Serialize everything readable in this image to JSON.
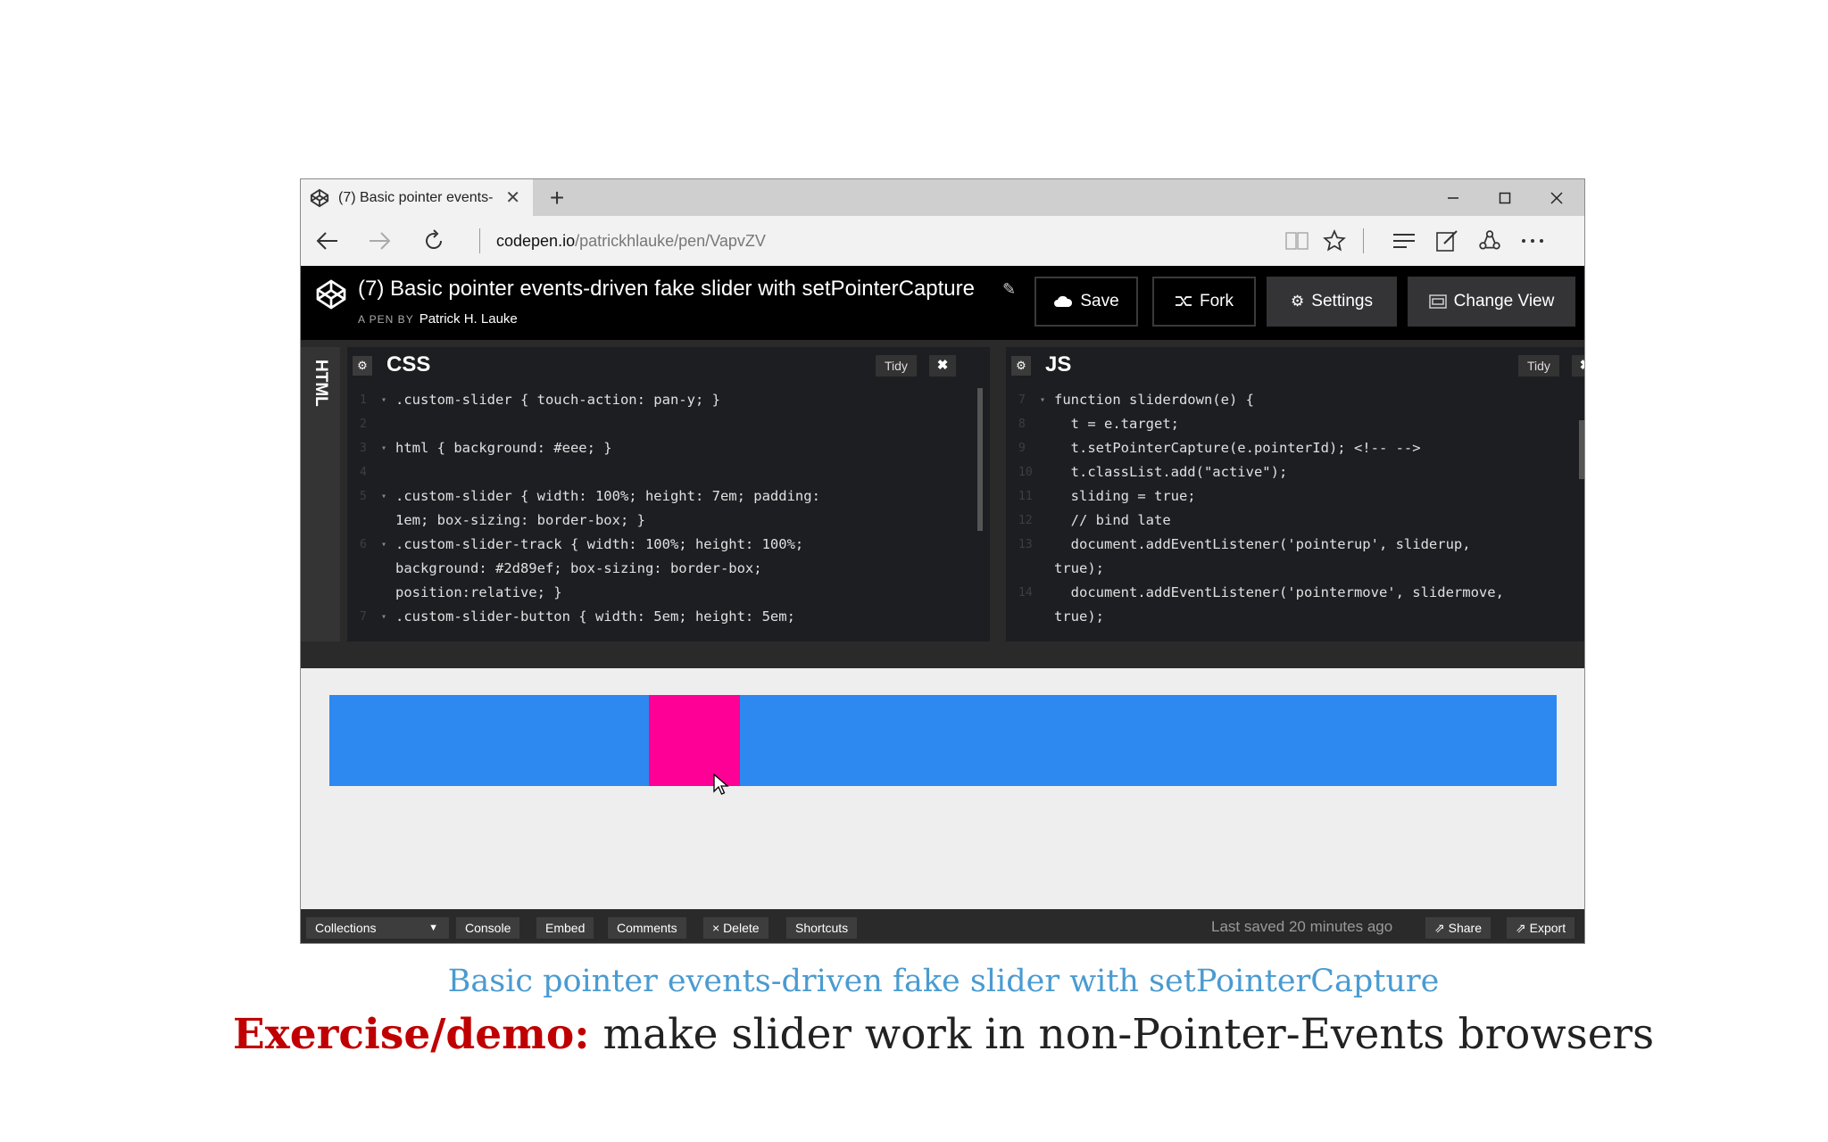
{
  "browser": {
    "tab_title": "(7) Basic pointer events-",
    "tab_close": "✕",
    "new_tab": "+",
    "url_host": "codepen.io",
    "url_path": "/patrickhlauke/pen/VapvZV"
  },
  "pen": {
    "title": "(7) Basic pointer events-driven fake slider with setPointerCapture",
    "edit_glyph": "✎",
    "by_prefix": "A PEN BY",
    "author": "Patrick H. Lauke",
    "buttons": {
      "save": "Save",
      "fork": "Fork",
      "settings": "Settings",
      "change_view": "Change View"
    }
  },
  "editors": {
    "html_label": "HTML",
    "css": {
      "title": "CSS",
      "tidy": "Tidy",
      "lines": [
        {
          "n": "1",
          "fold": "▾",
          "text": ".custom-slider { touch-action: pan-y; }"
        },
        {
          "n": "2",
          "fold": "",
          "text": ""
        },
        {
          "n": "3",
          "fold": "▾",
          "text": "html { background: #eee; }"
        },
        {
          "n": "4",
          "fold": "",
          "text": ""
        },
        {
          "n": "5",
          "fold": "▾",
          "text": ".custom-slider { width: 100%; height: 7em; padding:"
        },
        {
          "n": "",
          "fold": "",
          "text": "1em; box-sizing: border-box; }"
        },
        {
          "n": "6",
          "fold": "▾",
          "text": ".custom-slider-track { width: 100%; height: 100%;"
        },
        {
          "n": "",
          "fold": "",
          "text": "background: #2d89ef; box-sizing: border-box;"
        },
        {
          "n": "",
          "fold": "",
          "text": "position:relative; }"
        },
        {
          "n": "7",
          "fold": "▾",
          "text": ".custom-slider-button { width: 5em; height: 5em;"
        }
      ]
    },
    "js": {
      "title": "JS",
      "tidy": "Tidy",
      "lines": [
        {
          "n": "7",
          "fold": "▾",
          "text": "function sliderdown(e) {"
        },
        {
          "n": "8",
          "fold": "",
          "text": "  t = e.target;"
        },
        {
          "n": "9",
          "fold": "",
          "text": "  t.setPointerCapture(e.pointerId); <!-- -->"
        },
        {
          "n": "10",
          "fold": "",
          "text": "  t.classList.add(\"active\");"
        },
        {
          "n": "11",
          "fold": "",
          "text": "  sliding = true;"
        },
        {
          "n": "12",
          "fold": "",
          "text": "  // bind late"
        },
        {
          "n": "13",
          "fold": "",
          "text": "  document.addEventListener('pointerup', sliderup,"
        },
        {
          "n": "",
          "fold": "",
          "text": "true);"
        },
        {
          "n": "14",
          "fold": "",
          "text": "  document.addEventListener('pointermove', slidermove,"
        },
        {
          "n": "",
          "fold": "",
          "text": "true);"
        }
      ]
    }
  },
  "preview": {
    "track_color": "#2d89ef",
    "thumb_color": "#ff0096",
    "thumb_position_fraction": 0.26
  },
  "footer": {
    "collections": "Collections",
    "console": "Console",
    "embed": "Embed",
    "comments": "Comments",
    "delete": "× Delete",
    "shortcuts": "Shortcuts",
    "last_saved": "Last saved 20 minutes ago",
    "share": "Share",
    "export": "Export"
  },
  "slide": {
    "subtitle": "Basic pointer events-driven fake slider with setPointerCapture",
    "lead": "Exercise/demo:",
    "rest": " make slider work in non-Pointer-Events browsers"
  }
}
